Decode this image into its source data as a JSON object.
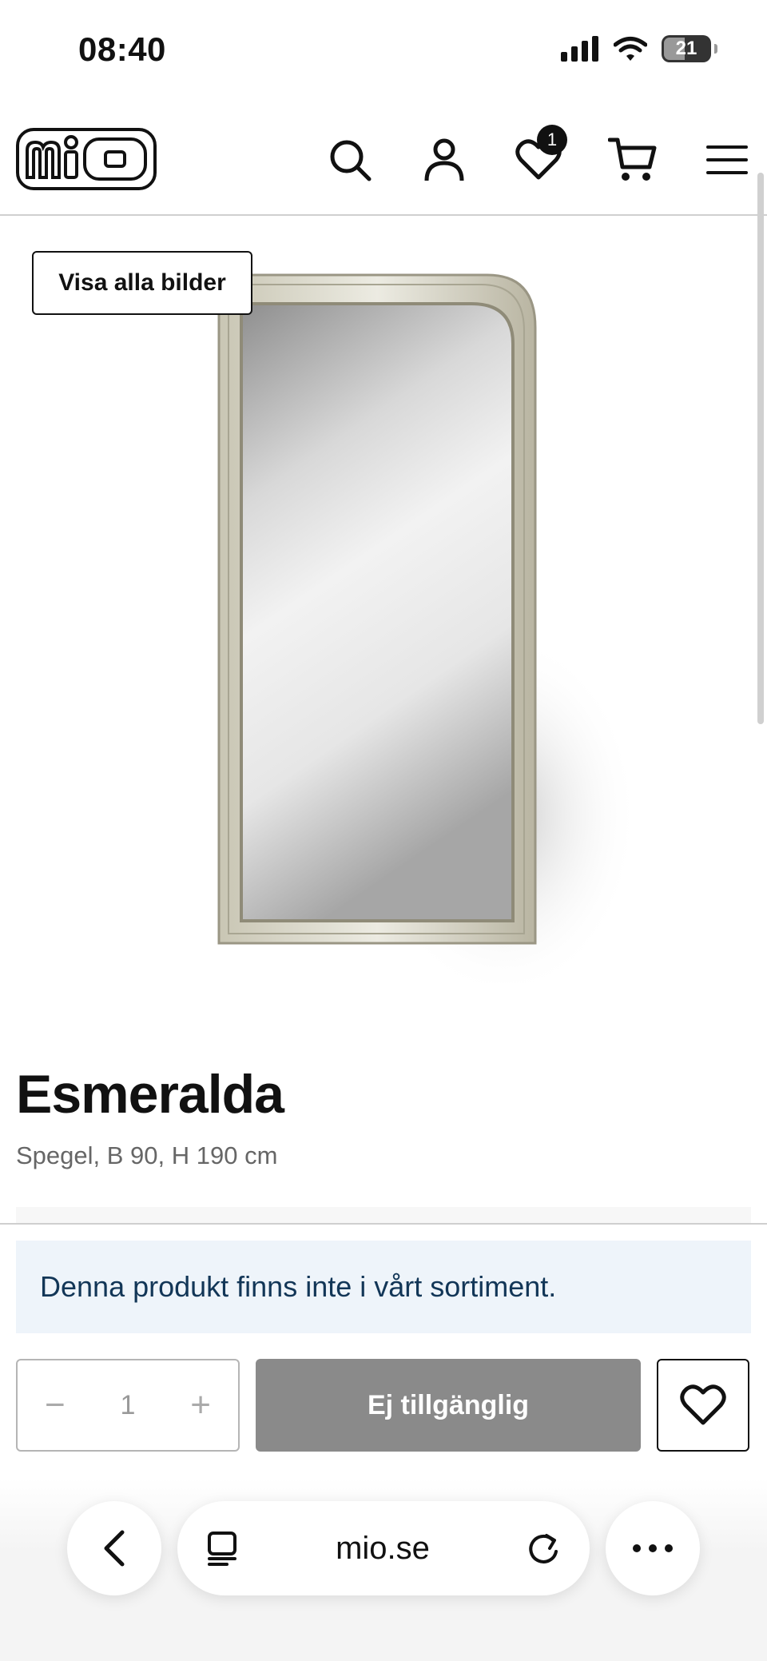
{
  "status": {
    "time": "08:40",
    "battery": "21"
  },
  "header": {
    "logo": "mio",
    "wishlist_count": "1"
  },
  "gallery": {
    "view_all_label": "Visa alla bilder"
  },
  "product": {
    "name": "Esmeralda",
    "description": "Spegel, B 90, H 190 cm",
    "availability_notice": "Denna produkt finns inte i vårt sortiment."
  },
  "purchase": {
    "quantity": "1",
    "minus": "−",
    "plus": "+",
    "button_label": "Ej tillgänglig"
  },
  "browser": {
    "url": "mio.se"
  },
  "colors": {
    "notice_bg": "#eef4fa",
    "notice_text": "#123657",
    "disabled_button": "#8a8a8a"
  },
  "icons": [
    "search-icon",
    "user-icon",
    "heart-icon",
    "cart-icon",
    "menu-icon",
    "back-icon",
    "reader-icon",
    "reload-icon",
    "more-icon"
  ]
}
